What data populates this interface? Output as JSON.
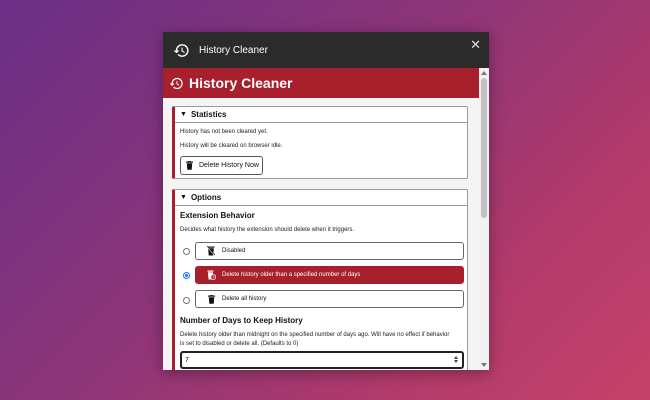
{
  "window": {
    "title": "History Cleaner",
    "close_label": "✕"
  },
  "header": {
    "title": "History Cleaner"
  },
  "statistics": {
    "heading": "Statistics",
    "line1": "History has not been cleared yet.",
    "line2": "History will be cleared on browser idle.",
    "delete_button": "Delete History Now"
  },
  "options": {
    "heading": "Options",
    "behavior": {
      "title": "Extension Behavior",
      "description": "Decides what history the extension should delete when it triggers.",
      "choices": [
        {
          "label": "Disabled",
          "selected": false
        },
        {
          "label": "Delete history older than a specified number of days",
          "selected": true
        },
        {
          "label": "Delete all history",
          "selected": false
        }
      ]
    },
    "days": {
      "title": "Number of Days to Keep History",
      "description_line1": "Delete history older than midnight on the specified number of days ago. Will have no effect if behavior",
      "description_line2": "is set to disabled or delete all. (Defaults to 0)",
      "value": "7"
    }
  },
  "colors": {
    "accent": "#a8202c",
    "titlebar": "#2b2b2b",
    "radio_selected": "#1a73e8"
  },
  "icons": {
    "window": "history-icon",
    "delete": "trash-icon",
    "disabled": "no-trash-icon",
    "older": "trash-clock-icon",
    "all": "trash-icon"
  }
}
